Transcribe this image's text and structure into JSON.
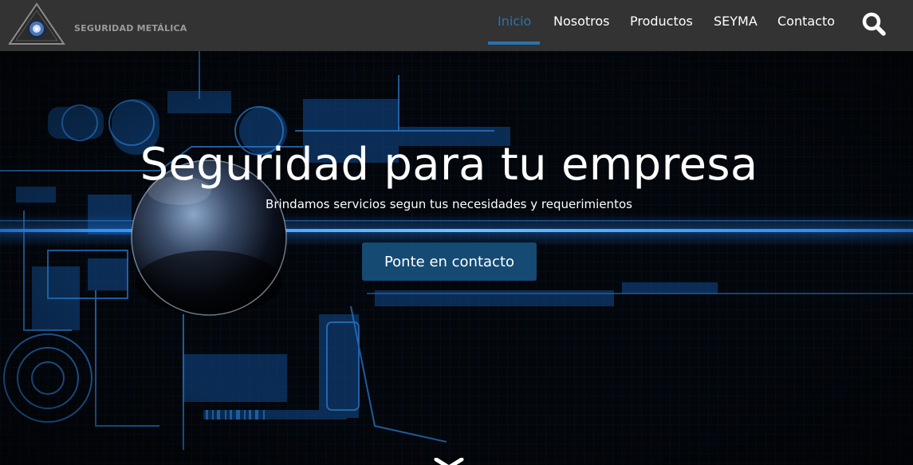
{
  "brand": {
    "name": "SEGURIDAD METÁLICA",
    "logo_icon": "triangle-eye-logo-icon"
  },
  "nav": {
    "items": [
      {
        "label": "Inicio",
        "active": true
      },
      {
        "label": "Nosotros",
        "active": false
      },
      {
        "label": "Productos",
        "active": false
      },
      {
        "label": "SEYMA",
        "active": false
      },
      {
        "label": "Contacto",
        "active": false
      }
    ],
    "search_icon": "search-icon"
  },
  "hero": {
    "title": "Seguridad para tu empresa",
    "subtitle": "Brindamos servicios segun tus necesidades y requerimientos",
    "cta_label": "Ponte en contacto",
    "scroll_icon": "chevron-down-icon"
  },
  "colors": {
    "navbar_bg": "#333333",
    "accent": "#2a73ad",
    "cta_bg": "#154a73",
    "hero_bg": "#03060b",
    "glow": "#1e8cff"
  }
}
